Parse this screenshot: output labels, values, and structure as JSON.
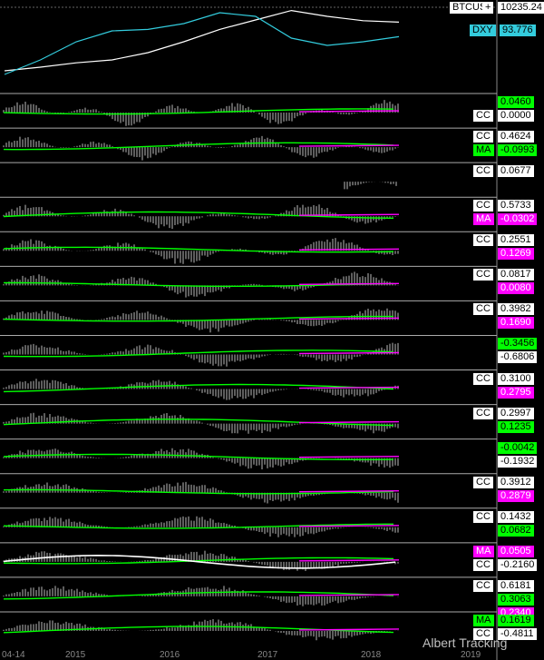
{
  "top": {
    "btc_label": "BTCUS",
    "btc_value": "10235.24",
    "dxy_label": "DXY",
    "dxy_value": "93.776",
    "plus": "+"
  },
  "x_labels": [
    "04-14",
    "2015",
    "2016",
    "2017",
    "2018",
    "2019"
  ],
  "watermark": "Albert Tracking",
  "panels": [
    {
      "badges": [
        {
          "label": "",
          "value": "0.0460",
          "style": "ma"
        },
        {
          "label": "CC",
          "value": "0.0000",
          "style": "cc"
        }
      ]
    },
    {
      "badges": [
        {
          "label": "CC",
          "value": "0.4624",
          "style": "cc"
        },
        {
          "label": "MA",
          "value": "-0.0993",
          "style": "ma"
        }
      ]
    },
    {
      "badges": [
        {
          "label": "CC",
          "value": "0.0677",
          "style": "cc"
        }
      ]
    },
    {
      "badges": [
        {
          "label": "CC",
          "value": "0.5733",
          "style": "cc"
        },
        {
          "label": "MA",
          "value": "-0.0302",
          "style": "mg"
        }
      ]
    },
    {
      "badges": [
        {
          "label": "CC",
          "value": "0.2551",
          "style": "cc"
        },
        {
          "label": "",
          "value": "0.1269",
          "style": "mg"
        }
      ]
    },
    {
      "badges": [
        {
          "label": "CC",
          "value": "0.0817",
          "style": "cc"
        },
        {
          "label": "",
          "value": "0.0080",
          "style": "mg"
        }
      ]
    },
    {
      "badges": [
        {
          "label": "CC",
          "value": "0.3982",
          "style": "cc"
        },
        {
          "label": "",
          "value": "0.1690",
          "style": "mg"
        }
      ]
    },
    {
      "badges": [
        {
          "label": "",
          "value": "-0.3456",
          "style": "ma"
        },
        {
          "label": "",
          "value": "-0.6806",
          "style": "cc"
        }
      ]
    },
    {
      "badges": [
        {
          "label": "CC",
          "value": "0.3100",
          "style": "cc"
        },
        {
          "label": "",
          "value": "0.2795",
          "style": "mg"
        }
      ]
    },
    {
      "badges": [
        {
          "label": "CC",
          "value": "0.2997",
          "style": "cc"
        },
        {
          "label": "",
          "value": "0.1235",
          "style": "ma"
        }
      ]
    },
    {
      "badges": [
        {
          "label": "",
          "value": "-0.0042",
          "style": "ma"
        },
        {
          "label": "",
          "value": "-0.1932",
          "style": "cc"
        }
      ]
    },
    {
      "badges": [
        {
          "label": "CC",
          "value": "0.3912",
          "style": "cc"
        },
        {
          "label": "",
          "value": "0.2879",
          "style": "mg"
        }
      ]
    },
    {
      "badges": [
        {
          "label": "CC",
          "value": "0.1432",
          "style": "cc"
        },
        {
          "label": "",
          "value": "0.0682",
          "style": "ma"
        }
      ]
    },
    {
      "badges": [
        {
          "label": "MA",
          "value": "0.0505",
          "style": "mg"
        },
        {
          "label": "CC",
          "value": "-0.2160",
          "style": "cc"
        }
      ]
    },
    {
      "badges": [
        {
          "label": "CC",
          "value": "0.6181",
          "style": "cc"
        },
        {
          "label": "",
          "value": "0.3063",
          "style": "ma"
        },
        {
          "label": "",
          "value": "0.2340",
          "style": "mg"
        }
      ]
    },
    {
      "badges": [
        {
          "label": "MA",
          "value": "0.1619",
          "style": "ma"
        },
        {
          "label": "CC",
          "value": "-0.4811",
          "style": "cc"
        }
      ]
    }
  ],
  "chart_data": {
    "type": "line",
    "series": [
      {
        "name": "BTCUS",
        "color": "#ffffff",
        "values": [
          0.15,
          0.2,
          0.26,
          0.3,
          0.4,
          0.55,
          0.72,
          0.85,
          0.98,
          0.9,
          0.84,
          0.82
        ]
      },
      {
        "name": "DXY",
        "color": "#33ccdd",
        "values": [
          0.1,
          0.3,
          0.55,
          0.7,
          0.72,
          0.8,
          0.95,
          0.9,
          0.6,
          0.5,
          0.55,
          0.62
        ]
      }
    ],
    "x_labels": [
      "04-14",
      "2015",
      "2016",
      "2017",
      "2018",
      "2019"
    ],
    "colors": {
      "histogram": "#bbbbbb",
      "cc_line": "#00ff00",
      "ma_line": "#ff00ff",
      "separator": "#aaaaaa"
    }
  }
}
